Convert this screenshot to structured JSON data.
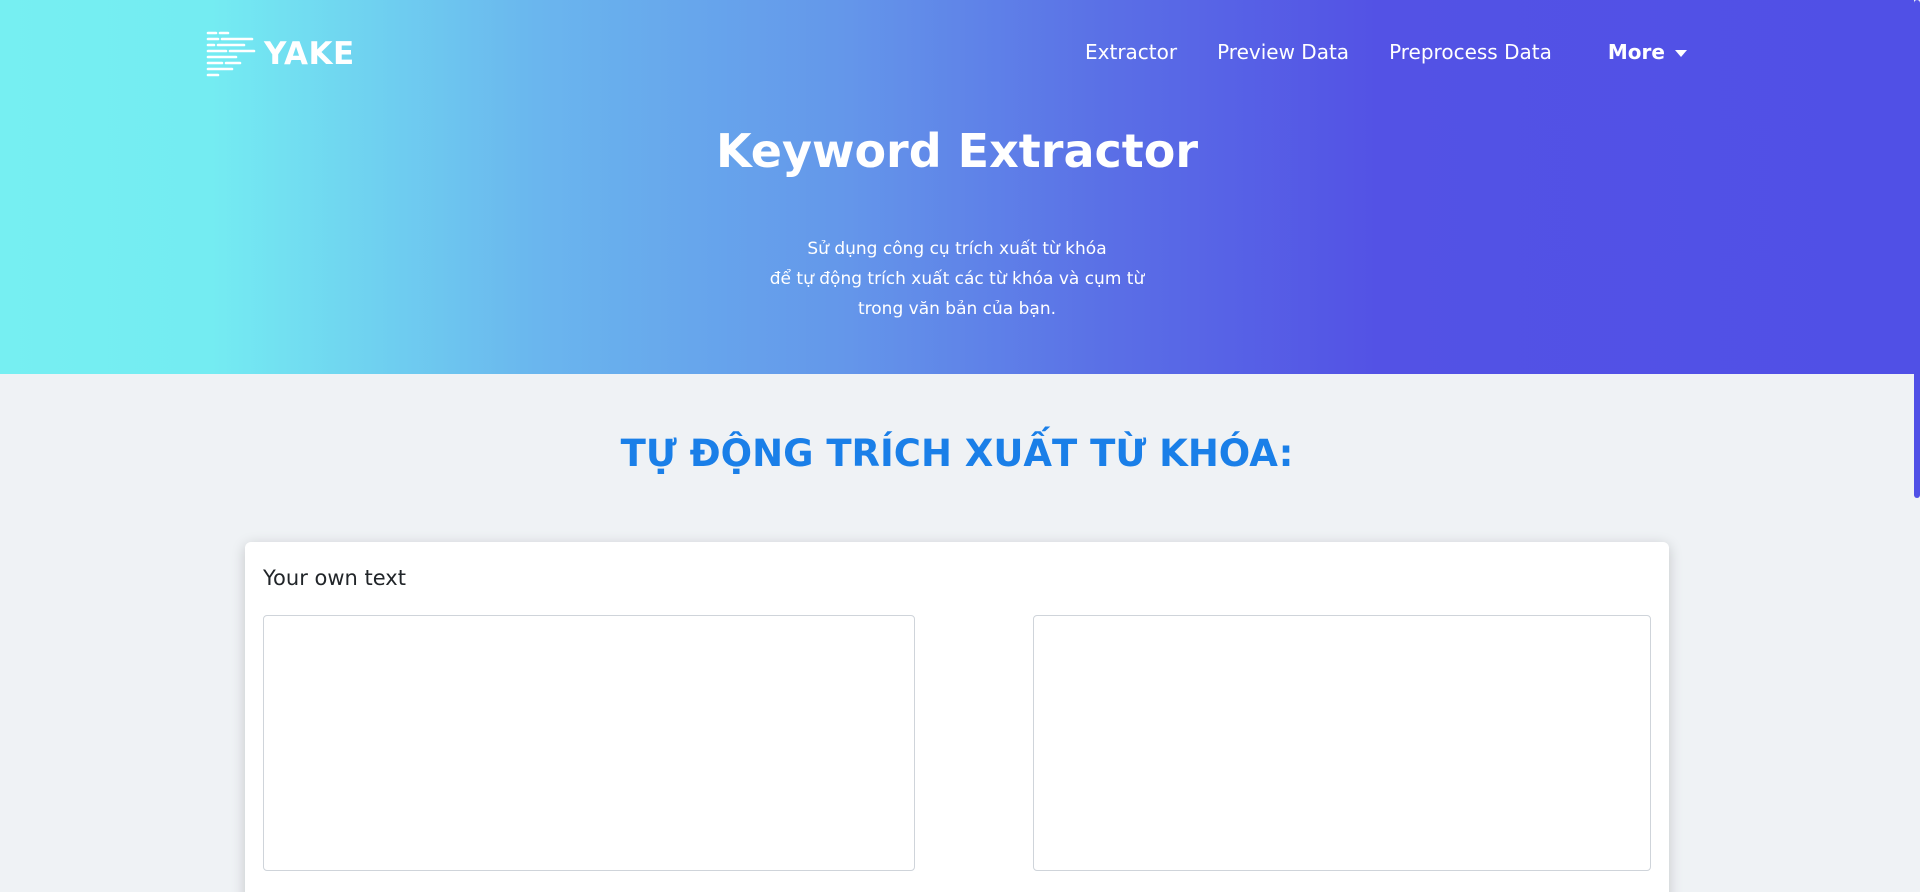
{
  "brand": {
    "name": "YAKE",
    "icon": "lines-logo-icon"
  },
  "nav": {
    "items": [
      {
        "label": "Extractor"
      },
      {
        "label": "Preview Data"
      },
      {
        "label": "Preprocess Data"
      }
    ],
    "more_label": "More",
    "more_icon": "caret-down-icon"
  },
  "hero": {
    "title": "Keyword Extractor",
    "description_lines": [
      "Sử dụng công cụ trích xuất từ khóa",
      "để tự động trích xuất các từ khóa và cụm từ",
      "trong văn bản của bạn."
    ]
  },
  "main": {
    "heading": "TỰ ĐỘNG TRÍCH XUẤT TỪ KHÓA:",
    "card": {
      "label": "Your own text",
      "input_value": "",
      "output_value": ""
    }
  },
  "colors": {
    "gradient_start": "#76eff2",
    "gradient_end": "#5050e6",
    "heading": "#1a7fe8",
    "background": "#eff2f5"
  }
}
